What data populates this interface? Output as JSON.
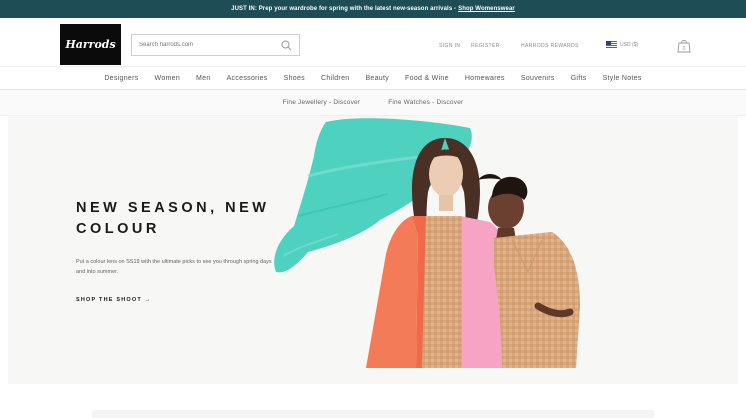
{
  "announcement": {
    "text": "JUST IN: Prep your wardrobe for spring with the latest new-season arrivals -",
    "link": "Shop Womenswear"
  },
  "header": {
    "logo": "Harrods",
    "search": {
      "placeholder": "Search harrods.com",
      "icon": "search-icon"
    },
    "sign_in": "SIGN IN",
    "register": "REGISTER",
    "rewards": "HARRODS REWARDS",
    "currency": "USD ($)",
    "bag_count": "0"
  },
  "main_nav": {
    "items": [
      "Designers",
      "Women",
      "Men",
      "Accessories",
      "Shoes",
      "Children",
      "Beauty",
      "Food & Wine",
      "Homewares",
      "Souvenirs",
      "Gifts",
      "Style Notes"
    ]
  },
  "sub_nav": {
    "items": [
      "Fine Jewellery - Discover",
      "Fine Watches - Discover"
    ]
  },
  "hero": {
    "title": "NEW SEASON, NEW COLOUR",
    "text": "Put a colour lens on SS19 with the ultimate picks to see you through spring days and into summer.",
    "cta": "SHOP THE SHOOT →"
  },
  "colors": {
    "announcement_bg": "#1f4d56",
    "paint_stroke": "#4fd1c0",
    "coral_jacket": "#f47b57",
    "pink_jacket": "#f7a3c4",
    "gingham": "#e0b58c"
  }
}
